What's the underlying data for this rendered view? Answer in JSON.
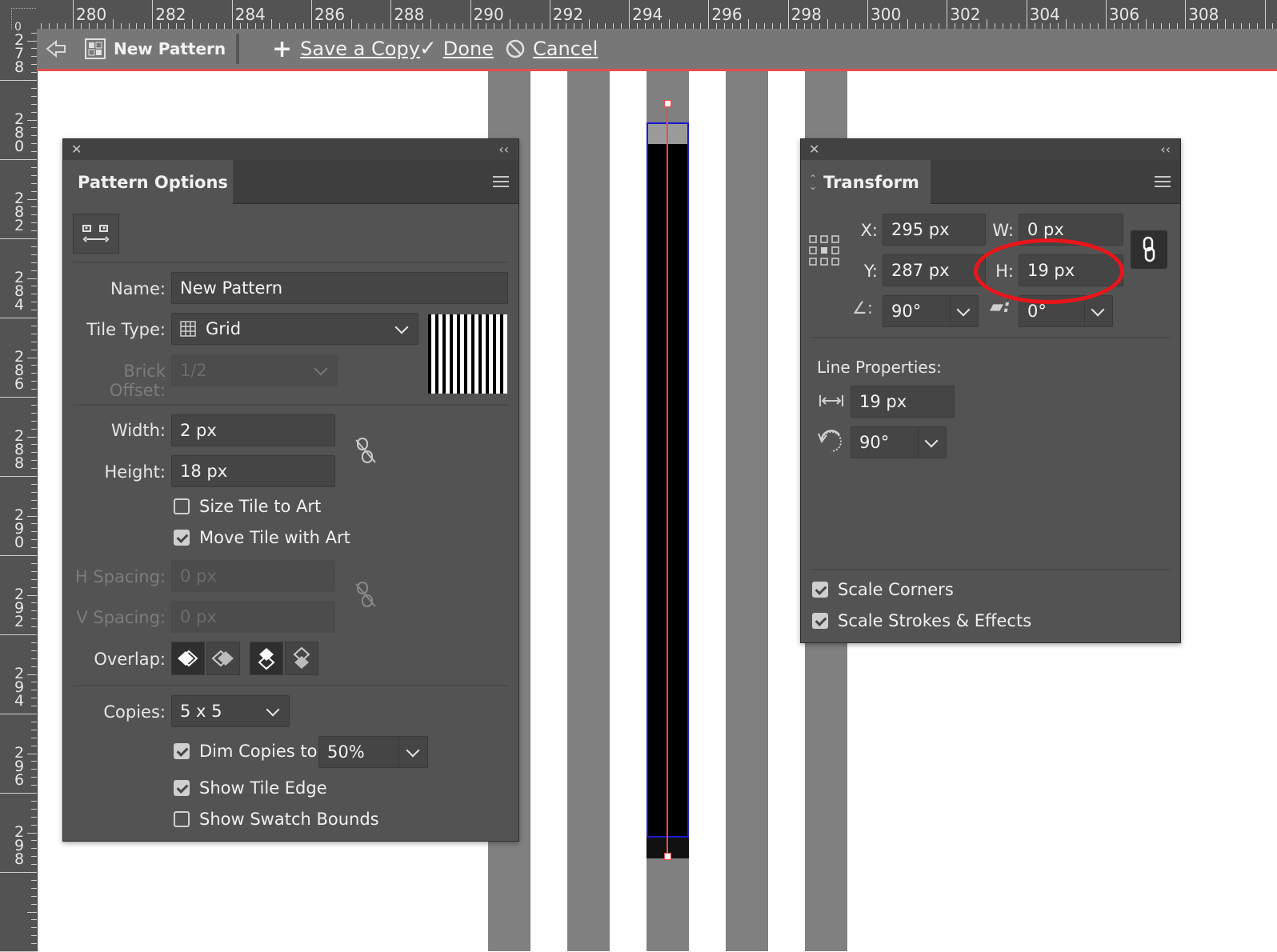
{
  "ruler": {
    "top_labels": [
      "280",
      "282",
      "284",
      "286",
      "288",
      "290",
      "292",
      "294",
      "296",
      "298",
      "300",
      "302",
      "304",
      "306",
      "308"
    ],
    "left_labels": [
      "278",
      "280",
      "282",
      "284",
      "286",
      "288",
      "290",
      "292",
      "294",
      "296",
      "298"
    ],
    "corner_label": "0"
  },
  "pattern_bar": {
    "title": "New Pattern",
    "save_copy": "Save a Copy",
    "done": "Done",
    "cancel": "Cancel"
  },
  "pattern_options": {
    "tab": "Pattern Options",
    "name_label": "Name:",
    "name_value": "New Pattern",
    "tile_type_label": "Tile Type:",
    "tile_type_value": "Grid",
    "brick_offset_label": "Brick Offset:",
    "brick_offset_value": "1/2",
    "width_label": "Width:",
    "width_value": "2 px",
    "height_label": "Height:",
    "height_value": "18 px",
    "size_tile_label": "Size Tile to Art",
    "size_tile_checked": false,
    "move_tile_label": "Move Tile with Art",
    "move_tile_checked": true,
    "h_spacing_label": "H Spacing:",
    "h_spacing_value": "0 px",
    "v_spacing_label": "V Spacing:",
    "v_spacing_value": "0 px",
    "overlap_label": "Overlap:",
    "copies_label": "Copies:",
    "copies_value": "5 x 5",
    "dim_label": "Dim Copies to:",
    "dim_checked": true,
    "dim_value": "50%",
    "show_edge_label": "Show Tile Edge",
    "show_edge_checked": true,
    "show_bounds_label": "Show Swatch Bounds",
    "show_bounds_checked": false
  },
  "transform": {
    "tab": "Transform",
    "x_label": "X:",
    "x_value": "295 px",
    "y_label": "Y:",
    "y_value": "287 px",
    "w_label": "W:",
    "w_value": "0 px",
    "h_label": "H:",
    "h_value": "19 px",
    "angle_value": "90°",
    "shear_value": "0°",
    "line_props_label": "Line Properties:",
    "line_length_value": "19 px",
    "line_angle_value": "90°",
    "scale_corners_label": "Scale Corners",
    "scale_corners_checked": true,
    "scale_strokes_label": "Scale Strokes & Effects",
    "scale_strokes_checked": true
  },
  "colors": {
    "highlight_ellipse": "#e8161b",
    "guide_line": "#e84c4c",
    "selection": "#1b1bcc"
  }
}
